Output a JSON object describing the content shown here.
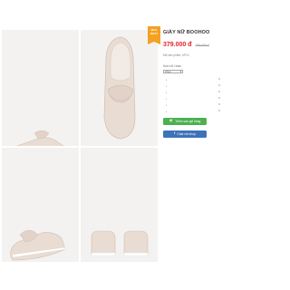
{
  "badge": {
    "line1": "MUA",
    "line2": "NGAY"
  },
  "product": {
    "title": "GIÀY NỮ BOOHOO",
    "price": "379.000 đ",
    "old_price": "759.000 đ",
    "sku_label": "Mã sản phẩm:",
    "sku_value": "#P10"
  },
  "size": {
    "label": "Kích cỡ / màu",
    "selected": "Chọn",
    "arrow_icon": "chevron-down-icon"
  },
  "options": [
    {
      "bullet": "•"
    },
    {
      "bullet": "•"
    },
    {
      "bullet": "•"
    },
    {
      "bullet": "•"
    },
    {
      "bullet": "•"
    },
    {
      "bullet": "•"
    }
  ],
  "buttons": {
    "cart_label": "Thêm vào giỏ hàng",
    "cart_icon": "cart-icon",
    "fb_label": "Chat với shop",
    "fb_icon": "facebook-icon"
  },
  "colors": {
    "price": "#e8222b",
    "cart_button": "#4cb050",
    "fb_button": "#3d73b9",
    "badge": "#f4a124"
  }
}
